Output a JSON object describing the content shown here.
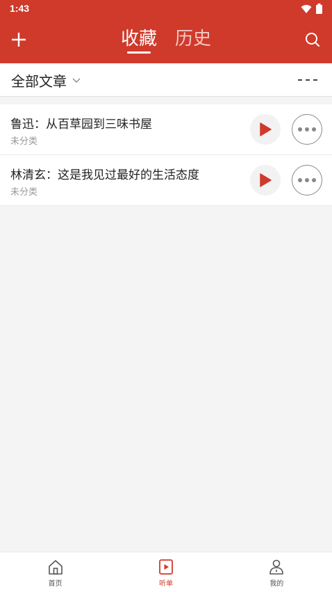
{
  "status_bar": {
    "time": "1:43",
    "icons": [
      "wifi-icon",
      "battery-icon"
    ]
  },
  "header": {
    "tabs": [
      {
        "label": "收藏",
        "active": true
      },
      {
        "label": "历史",
        "active": false
      }
    ],
    "left_icon": "plus-icon",
    "right_icon": "search-icon",
    "accent_color": "#cf3a2b"
  },
  "filter": {
    "label": "全部文章",
    "dropdown_icon": "chevron-down-icon",
    "more_icon": "more-dashes-icon"
  },
  "items": [
    {
      "title": "鲁迅：从百草园到三味书屋",
      "category": "未分类"
    },
    {
      "title": "林清玄：这是我见过最好的生活态度",
      "category": "未分类"
    }
  ],
  "bottom_nav": [
    {
      "label": "首页",
      "icon": "home-icon",
      "active": false
    },
    {
      "label": "听单",
      "icon": "playlist-icon",
      "active": true
    },
    {
      "label": "我的",
      "icon": "profile-icon",
      "active": false
    }
  ]
}
